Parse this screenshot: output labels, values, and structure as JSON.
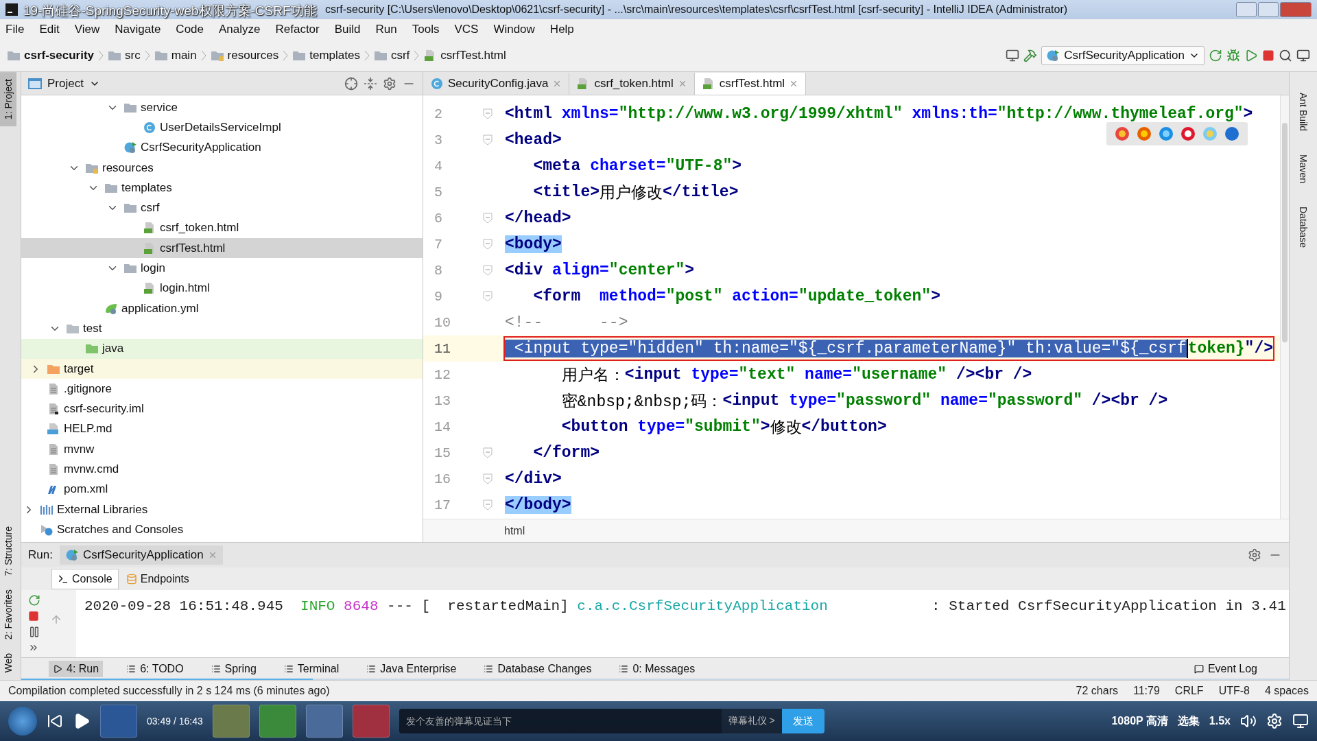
{
  "window": {
    "title": "csrf-security [C:\\Users\\lenovo\\Desktop\\0621\\csrf-security] - ...\\src\\main\\resources\\templates\\csrf\\csrfTest.html [csrf-security] - IntelliJ IDEA (Administrator)",
    "video_title": "19-尚硅谷-SpringSecurity-web权限方案-CSRF功能"
  },
  "menu": [
    "File",
    "Edit",
    "View",
    "Navigate",
    "Code",
    "Analyze",
    "Refactor",
    "Build",
    "Run",
    "Tools",
    "VCS",
    "Window",
    "Help"
  ],
  "navbar": {
    "breadcrumbs": [
      {
        "label": "csrf-security",
        "kind": "module"
      },
      {
        "label": "src",
        "kind": "folder"
      },
      {
        "label": "main",
        "kind": "folder"
      },
      {
        "label": "resources",
        "kind": "resources"
      },
      {
        "label": "templates",
        "kind": "folder"
      },
      {
        "label": "csrf",
        "kind": "folder"
      },
      {
        "label": "csrfTest.html",
        "kind": "html"
      }
    ],
    "run_config": "CsrfSecurityApplication"
  },
  "left_strip": [
    {
      "label": "1: Project",
      "selected": true
    },
    {
      "label": "7: Structure",
      "selected": false
    },
    {
      "label": "2: Favorites",
      "selected": false
    },
    {
      "label": "Web",
      "selected": false
    }
  ],
  "right_strip": [
    "Ant Build",
    "Maven",
    "Database"
  ],
  "project": {
    "title": "Project",
    "tree": [
      {
        "children": [
          {
            "children": [
              {
                "children": [
                  {
                    "children": [
                      {
                        "children": [
                          {
                            "label": "service",
                            "kind": "folder",
                            "expanded": true,
                            "selected": false,
                            "children": [
                              {
                                "label": "UserDetailsServiceImpl",
                                "kind": "class",
                                "selected": false
                              }
                            ]
                          },
                          {
                            "label": "CsrfSecurityApplication",
                            "kind": "spring-app",
                            "selected": false
                          }
                        ]
                      }
                    ]
                  },
                  {
                    "label": "resources",
                    "kind": "resources",
                    "expanded": true,
                    "selected": false,
                    "children": [
                      {
                        "label": "templates",
                        "kind": "folder",
                        "expanded": true,
                        "selected": false,
                        "children": [
                          {
                            "label": "csrf",
                            "kind": "folder",
                            "expanded": true,
                            "selected": false,
                            "children": [
                              {
                                "label": "csrf_token.html",
                                "kind": "html",
                                "selected": false
                              },
                              {
                                "label": "csrfTest.html",
                                "kind": "html",
                                "selected": true
                              }
                            ]
                          },
                          {
                            "label": "login",
                            "kind": "folder",
                            "expanded": true,
                            "selected": false,
                            "children": [
                              {
                                "label": "login.html",
                                "kind": "html",
                                "selected": false
                              }
                            ]
                          }
                        ]
                      },
                      {
                        "label": "application.yml",
                        "kind": "yml",
                        "selected": false
                      }
                    ]
                  }
                ]
              },
              {
                "label": "test",
                "kind": "plain-folder",
                "expanded": true,
                "selected": false,
                "children": [
                  {
                    "label": "java",
                    "kind": "test-folder",
                    "selected": false
                  }
                ]
              }
            ]
          },
          {
            "label": "target",
            "kind": "excluded-folder",
            "expanded": false,
            "selected": false
          },
          {
            "label": ".gitignore",
            "kind": "text-file",
            "selected": false
          },
          {
            "label": "csrf-security.iml",
            "kind": "iml",
            "selected": false
          },
          {
            "label": "HELP.md",
            "kind": "md",
            "selected": false
          },
          {
            "label": "mvnw",
            "kind": "text-file",
            "selected": false
          },
          {
            "label": "mvnw.cmd",
            "kind": "text-file",
            "selected": false
          },
          {
            "label": "pom.xml",
            "kind": "maven",
            "selected": false
          }
        ]
      },
      {
        "label": "External Libraries",
        "kind": "libraries",
        "expanded": false,
        "selected": false
      },
      {
        "label": "Scratches and Consoles",
        "kind": "scratches",
        "selected": false
      }
    ]
  },
  "editor": {
    "tabs": [
      {
        "label": "SecurityConfig.java",
        "kind": "class",
        "selected": false
      },
      {
        "label": "csrf_token.html",
        "kind": "html",
        "selected": false
      },
      {
        "label": "csrfTest.html",
        "kind": "html",
        "selected": true
      }
    ],
    "lines": [
      {
        "number": "2",
        "fold": true,
        "current": false,
        "boxed": false,
        "segments": [
          {
            "text": "<html",
            "kind": "tag"
          },
          {
            "text": " xmlns=",
            "kind": "attr"
          },
          {
            "text": "\"http://www.w3.org/1999/xhtml\"",
            "kind": "str"
          },
          {
            "text": " xmlns:th=",
            "kind": "attr"
          },
          {
            "text": "\"http://www.thymeleaf.org\"",
            "kind": "str"
          },
          {
            "text": ">",
            "kind": "tag"
          }
        ]
      },
      {
        "number": "3",
        "fold": true,
        "current": false,
        "boxed": false,
        "segments": [
          {
            "text": "<head>",
            "kind": "tag"
          }
        ]
      },
      {
        "number": "4",
        "fold": false,
        "current": false,
        "boxed": false,
        "segments": [
          {
            "text": "   <meta",
            "kind": "tag"
          },
          {
            "text": " charset=",
            "kind": "attr"
          },
          {
            "text": "\"UTF-8\"",
            "kind": "str"
          },
          {
            "text": ">",
            "kind": "tag"
          }
        ]
      },
      {
        "number": "5",
        "fold": false,
        "current": false,
        "boxed": false,
        "segments": [
          {
            "text": "   <title>",
            "kind": "tag"
          },
          {
            "text": "用户修改",
            "kind": "text"
          },
          {
            "text": "</title>",
            "kind": "tag"
          }
        ]
      },
      {
        "number": "6",
        "fold": true,
        "current": false,
        "boxed": false,
        "segments": [
          {
            "text": "</head>",
            "kind": "tag"
          }
        ]
      },
      {
        "number": "7",
        "fold": true,
        "current": false,
        "boxed": false,
        "segments": [
          {
            "text": "<body>",
            "kind": "match"
          }
        ]
      },
      {
        "number": "8",
        "fold": true,
        "current": false,
        "boxed": false,
        "segments": [
          {
            "text": "<div",
            "kind": "tag"
          },
          {
            "text": " align=",
            "kind": "attr"
          },
          {
            "text": "\"center\"",
            "kind": "str"
          },
          {
            "text": ">",
            "kind": "tag"
          }
        ]
      },
      {
        "number": "9",
        "fold": true,
        "current": false,
        "boxed": false,
        "segments": [
          {
            "text": "   <form",
            "kind": "tag"
          },
          {
            "text": "  method=",
            "kind": "attr"
          },
          {
            "text": "\"post\"",
            "kind": "str"
          },
          {
            "text": " action=",
            "kind": "attr"
          },
          {
            "text": "\"update_token\"",
            "kind": "str"
          },
          {
            "text": ">",
            "kind": "tag"
          }
        ]
      },
      {
        "number": "10",
        "fold": false,
        "current": false,
        "boxed": false,
        "segments": [
          {
            "text": "<!--      -->",
            "kind": "comment"
          }
        ]
      },
      {
        "number": "11",
        "fold": false,
        "current": true,
        "boxed": true,
        "segments": [
          {
            "text": " <input type=\"hidden\" th:name=\"${_csrf.parameterName}\" th:value=\"${_csrf",
            "kind": "sel"
          },
          {
            "text": "token}",
            "kind": "str"
          },
          {
            "text": "\"/>",
            "kind": "tag"
          }
        ]
      },
      {
        "number": "12",
        "fold": false,
        "current": false,
        "boxed": false,
        "segments": [
          {
            "text": "      用户名：",
            "kind": "text"
          },
          {
            "text": "<input",
            "kind": "tag"
          },
          {
            "text": " type=",
            "kind": "attr"
          },
          {
            "text": "\"text\"",
            "kind": "str"
          },
          {
            "text": " name=",
            "kind": "attr"
          },
          {
            "text": "\"username\"",
            "kind": "str"
          },
          {
            "text": " /><br />",
            "kind": "tag"
          }
        ]
      },
      {
        "number": "13",
        "fold": false,
        "current": false,
        "boxed": false,
        "segments": [
          {
            "text": "      密&nbsp;&nbsp;码：",
            "kind": "text"
          },
          {
            "text": "<input",
            "kind": "tag"
          },
          {
            "text": " type=",
            "kind": "attr"
          },
          {
            "text": "\"password\"",
            "kind": "str"
          },
          {
            "text": " name=",
            "kind": "attr"
          },
          {
            "text": "\"password\"",
            "kind": "str"
          },
          {
            "text": " /><br />",
            "kind": "tag"
          }
        ]
      },
      {
        "number": "14",
        "fold": false,
        "current": false,
        "boxed": false,
        "segments": [
          {
            "text": "      <button",
            "kind": "tag"
          },
          {
            "text": " type=",
            "kind": "attr"
          },
          {
            "text": "\"submit\"",
            "kind": "str"
          },
          {
            "text": ">",
            "kind": "tag"
          },
          {
            "text": "修改",
            "kind": "text"
          },
          {
            "text": "</button>",
            "kind": "tag"
          }
        ]
      },
      {
        "number": "15",
        "fold": true,
        "current": false,
        "boxed": false,
        "segments": [
          {
            "text": "   </form>",
            "kind": "tag"
          }
        ]
      },
      {
        "number": "16",
        "fold": true,
        "current": false,
        "boxed": false,
        "segments": [
          {
            "text": "</div>",
            "kind": "tag"
          }
        ]
      },
      {
        "number": "17",
        "fold": true,
        "current": false,
        "boxed": false,
        "segments": [
          {
            "text": "</body>",
            "kind": "match"
          }
        ]
      }
    ],
    "breadcrumb": "html"
  },
  "run": {
    "label": "Run:",
    "config_tab": "CsrfSecurityApplication",
    "tabs": [
      {
        "label": "Console",
        "selected": true
      },
      {
        "label": "Endpoints",
        "selected": false
      }
    ],
    "log": [
      [
        {
          "text": "2020-09-28 16:51:48.945  ",
          "kind": "plain"
        },
        {
          "text": "INFO ",
          "kind": "info"
        },
        {
          "text": "8648",
          "kind": "pid"
        },
        {
          "text": " --- [  restartedMain] ",
          "kind": "plain"
        },
        {
          "text": "c.a.c.CsrfSecurityApplication",
          "kind": "logger"
        },
        {
          "text": "            : Started CsrfSecurityApplication in 3.41",
          "kind": "plain"
        }
      ]
    ]
  },
  "tool_tabs": [
    {
      "label": "4: Run",
      "selected": true
    },
    {
      "label": "6: TODO",
      "selected": false
    },
    {
      "label": "Spring",
      "selected": false
    },
    {
      "label": "Terminal",
      "selected": false
    },
    {
      "label": "Java Enterprise",
      "selected": false
    },
    {
      "label": "Database Changes",
      "selected": false
    },
    {
      "label": "0: Messages",
      "selected": false
    }
  ],
  "event_log": "Event Log",
  "status": {
    "message": "Compilation completed successfully in 2 s 124 ms (6 minutes ago)",
    "items": [
      "72 chars",
      "11:79",
      "CRLF",
      "UTF-8",
      "4 spaces"
    ]
  },
  "player": {
    "level": 0.23,
    "time": "03:49 / 16:43",
    "danmaku_placeholder": "发个友善的弹幕见证当下",
    "etiquette": "弹幕礼仪 >",
    "send": "发送",
    "quality": "1080P 高清",
    "episodes": "选集",
    "speed": "1.5x"
  }
}
